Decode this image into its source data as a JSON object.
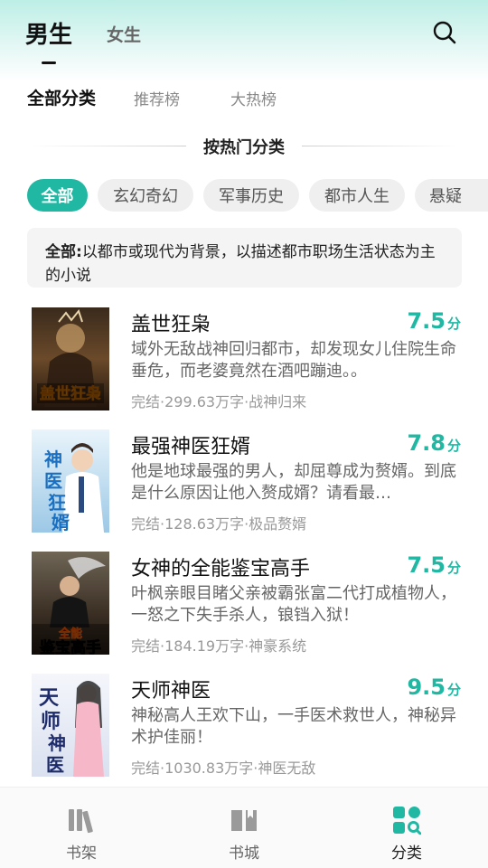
{
  "header": {
    "gender_tabs": [
      {
        "label": "男生",
        "active": true
      },
      {
        "label": "女生",
        "active": false
      }
    ],
    "search_icon": "search-icon"
  },
  "category_tabs": [
    {
      "label": "全部分类",
      "active": true
    },
    {
      "label": "推荐榜",
      "active": false
    },
    {
      "label": "大热榜",
      "active": false
    }
  ],
  "section_title": "按热门分类",
  "chips": [
    {
      "label": "全部",
      "active": true
    },
    {
      "label": "玄幻奇幻",
      "active": false
    },
    {
      "label": "军事历史",
      "active": false
    },
    {
      "label": "都市人生",
      "active": false
    },
    {
      "label": "悬疑",
      "active": false
    }
  ],
  "description": {
    "prefix": "全部:",
    "text": "以都市或现代为背景，以描述都市职场生活状态为主的小说"
  },
  "books": [
    {
      "title": "盖世狂枭",
      "score": "7.5",
      "score_unit": "分",
      "desc": "域外无敌战神回归都市，却发现女儿住院生命垂危，而老婆竟然在酒吧蹦迪。。",
      "meta": "完结·299.63万字·战神归来",
      "cover_text": "盖世狂枭"
    },
    {
      "title": "最强神医狂婿",
      "score": "7.8",
      "score_unit": "分",
      "desc": "他是地球最强的男人，却屈尊成为赘婿。到底是什么原因让他入赘成婿？请看最…",
      "meta": "完结·128.63万字·极品赘婿",
      "cover_text": "神医狂婿"
    },
    {
      "title": "女神的全能鉴宝高手",
      "score": "7.5",
      "score_unit": "分",
      "desc": "叶枫亲眼目睹父亲被霸张富二代打成植物人，一怒之下失手杀人，锒铛入狱！",
      "meta": "完结·184.19万字·神豪系统",
      "cover_text": "全能鉴宝高手"
    },
    {
      "title": "天师神医",
      "score": "9.5",
      "score_unit": "分",
      "desc": "神秘高人王欢下山，一手医术救世人，神秘异术护佳丽！",
      "meta": "完结·1030.83万字·神医无敌",
      "cover_text": "天师神医"
    }
  ],
  "tabbar": [
    {
      "label": "书架",
      "icon": "bookshelf-icon",
      "active": false
    },
    {
      "label": "书城",
      "icon": "bookstore-icon",
      "active": false
    },
    {
      "label": "分类",
      "icon": "category-grid-icon",
      "active": true
    }
  ],
  "colors": {
    "accent": "#20b8a3",
    "chip_bg": "#efefef",
    "desc_bg": "#f4f4f4"
  }
}
